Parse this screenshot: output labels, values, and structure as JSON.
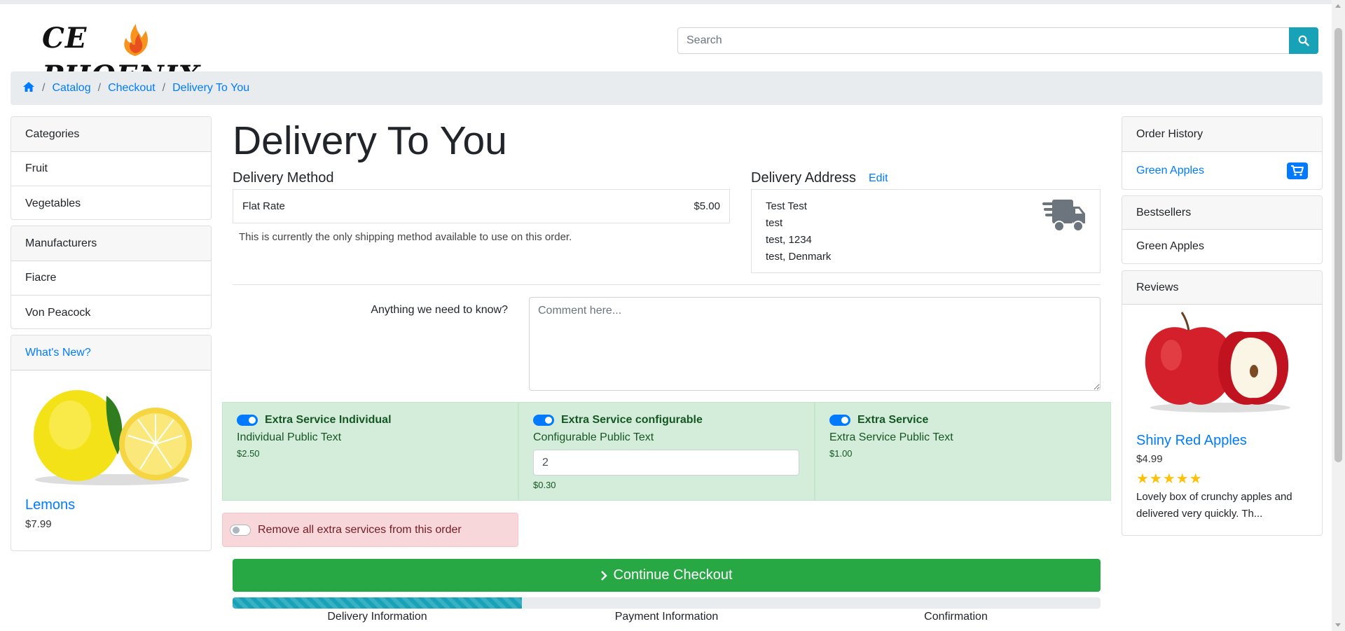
{
  "header": {
    "logo_text": "CE PHOENIX",
    "search_placeholder": "Search"
  },
  "breadcrumb": {
    "home_icon": "home-icon",
    "items": [
      "Catalog",
      "Checkout",
      "Delivery To You"
    ]
  },
  "left_sidebar": {
    "categories": {
      "title": "Categories",
      "items": [
        "Fruit",
        "Vegetables"
      ]
    },
    "manufacturers": {
      "title": "Manufacturers",
      "items": [
        "Fiacre",
        "Von Peacock"
      ]
    },
    "whats_new": {
      "title": "What's New?",
      "product_name": "Lemons",
      "price": "$7.99",
      "image": "lemons-image"
    }
  },
  "main": {
    "page_title": "Delivery To You",
    "delivery_method": {
      "heading": "Delivery Method",
      "method": "Flat Rate",
      "price": "$5.00",
      "note": "This is currently the only shipping method available to use on this order."
    },
    "delivery_address": {
      "heading": "Delivery Address",
      "edit_label": "Edit",
      "lines": [
        "Test Test",
        "test",
        "test, 1234",
        "test, Denmark"
      ],
      "icon": "truck-icon"
    },
    "comment": {
      "label": "Anything we need to know?",
      "placeholder": "Comment here..."
    },
    "extra_services": [
      {
        "title": "Extra Service Individual",
        "public_text": "Individual Public Text",
        "price": "$2.50",
        "enabled": true
      },
      {
        "title": "Extra Service configurable",
        "public_text": "Configurable Public Text",
        "input_value": "2",
        "price": "$0.30",
        "enabled": true
      },
      {
        "title": "Extra Service",
        "public_text": "Extra Service Public Text",
        "price": "$1.00",
        "enabled": true
      }
    ],
    "remove_all_label": "Remove all extra services from this order",
    "continue_label": "Continue Checkout",
    "progress": {
      "percent": 33.3,
      "steps": [
        "Delivery Information",
        "Payment Information",
        "Confirmation"
      ]
    }
  },
  "right_sidebar": {
    "order_history": {
      "title": "Order History",
      "item": "Green Apples",
      "icon": "cart-icon"
    },
    "bestsellers": {
      "title": "Bestsellers",
      "item": "Green Apples"
    },
    "reviews": {
      "title": "Reviews",
      "product_name": "Shiny Red Apples",
      "price": "$4.99",
      "rating": 5,
      "stars": "★★★★★",
      "text": "Lovely box of crunchy apples and delivered very quickly. Th...",
      "image": "red-apples-image"
    }
  },
  "colors": {
    "link": "#007bff",
    "success": "#28a745",
    "info": "#17a2b8",
    "service_bg": "#d4edda",
    "danger_bg": "#f8d7da"
  }
}
